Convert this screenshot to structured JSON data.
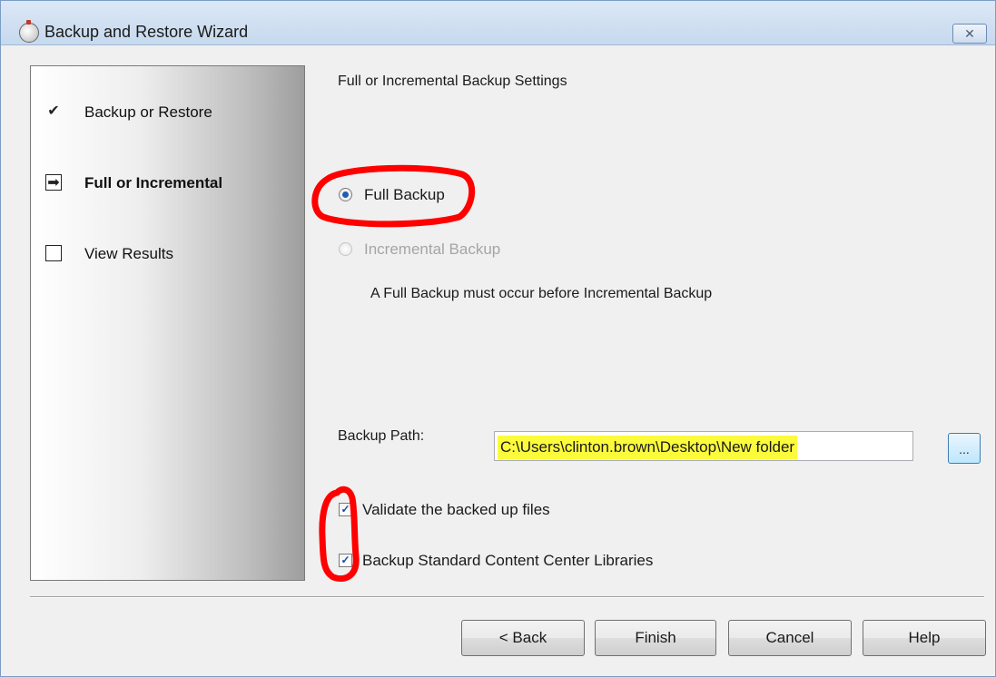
{
  "window": {
    "title": "Backup and Restore Wizard",
    "close_glyph": "✕"
  },
  "sidebar": {
    "steps": [
      {
        "label": "Backup or Restore",
        "state": "done",
        "glyph": "✔"
      },
      {
        "label": "Full or Incremental",
        "state": "current",
        "glyph": "➡"
      },
      {
        "label": "View Results",
        "state": "pending",
        "glyph": ""
      }
    ]
  },
  "main": {
    "section_title": "Full or Incremental Backup Settings",
    "options": [
      {
        "label": "Full Backup",
        "selected": true,
        "enabled": true
      },
      {
        "label": "Incremental Backup",
        "selected": false,
        "enabled": false
      }
    ],
    "note": "A Full Backup must occur before Incremental Backup",
    "backup_path": {
      "label": "Backup Path:",
      "value": "C:\\Users\\clinton.brown\\Desktop\\New folder",
      "browse_label": "..."
    },
    "checkboxes": [
      {
        "label": "Validate the backed up files",
        "checked": true,
        "glyph": "✓"
      },
      {
        "label": "Backup Standard Content Center Libraries",
        "checked": true,
        "glyph": "✓"
      }
    ]
  },
  "buttons": {
    "back": "< Back",
    "finish": "Finish",
    "cancel": "Cancel",
    "help": "Help"
  },
  "colors": {
    "highlight": "#fbfb3c",
    "annotation": "#ff0000",
    "title_bar": "#c6d9ee"
  }
}
